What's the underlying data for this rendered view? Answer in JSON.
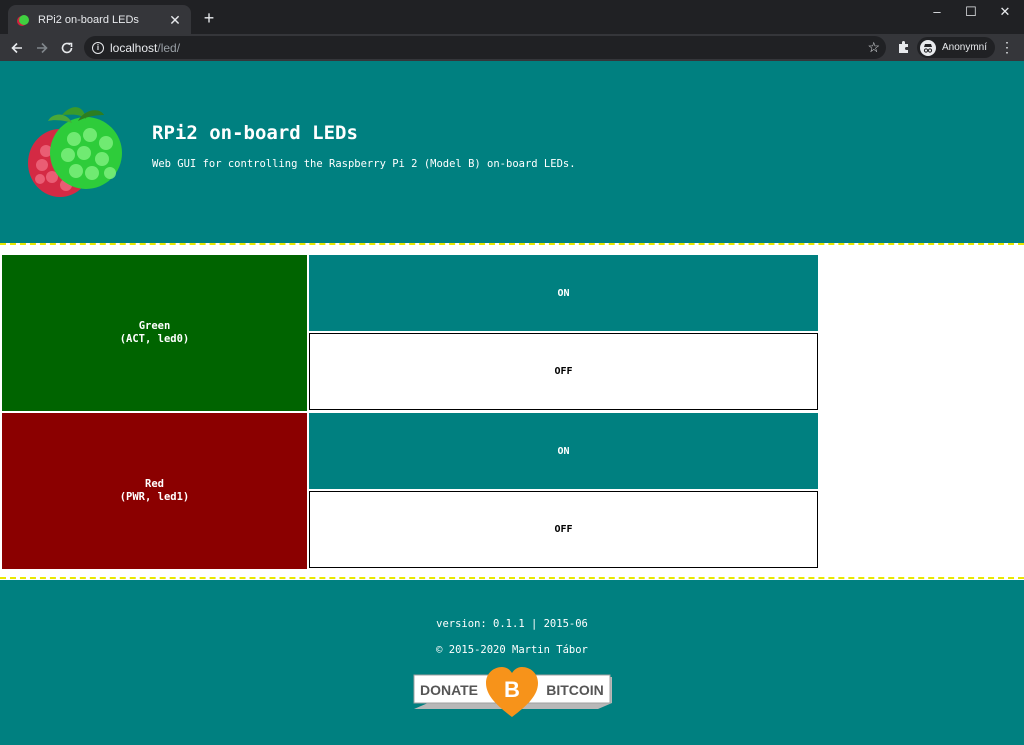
{
  "browser": {
    "tab_title": "RPi2 on-board LEDs",
    "tab_close": "✕",
    "new_tab": "+",
    "url_host": "localhost",
    "url_path": "/led/",
    "profile_label": "Anonymní",
    "window_controls": [
      "–",
      "☐",
      "✕"
    ]
  },
  "header": {
    "title": "RPi2 on-board LEDs",
    "subtitle": "Web GUI for controlling the Raspberry Pi 2 (Model B) on-board LEDs."
  },
  "leds": [
    {
      "name": "Green",
      "detail": "(ACT, led0)",
      "on_label": "ON",
      "off_label": "OFF",
      "color": "#006400"
    },
    {
      "name": "Red",
      "detail": "(PWR, led1)",
      "on_label": "ON",
      "off_label": "OFF",
      "color": "#8b0000"
    }
  ],
  "footer": {
    "version": "version: 0.1.1 | 2015-06",
    "copyright": "© 2015-2020 Martin Tábor",
    "donate_left": "DONATE",
    "donate_right": "BITCOIN",
    "donate_symbol": "B"
  },
  "colors": {
    "teal": "#008080",
    "dashed_border": "#e8e800",
    "bitcoin_orange": "#f7931a"
  }
}
